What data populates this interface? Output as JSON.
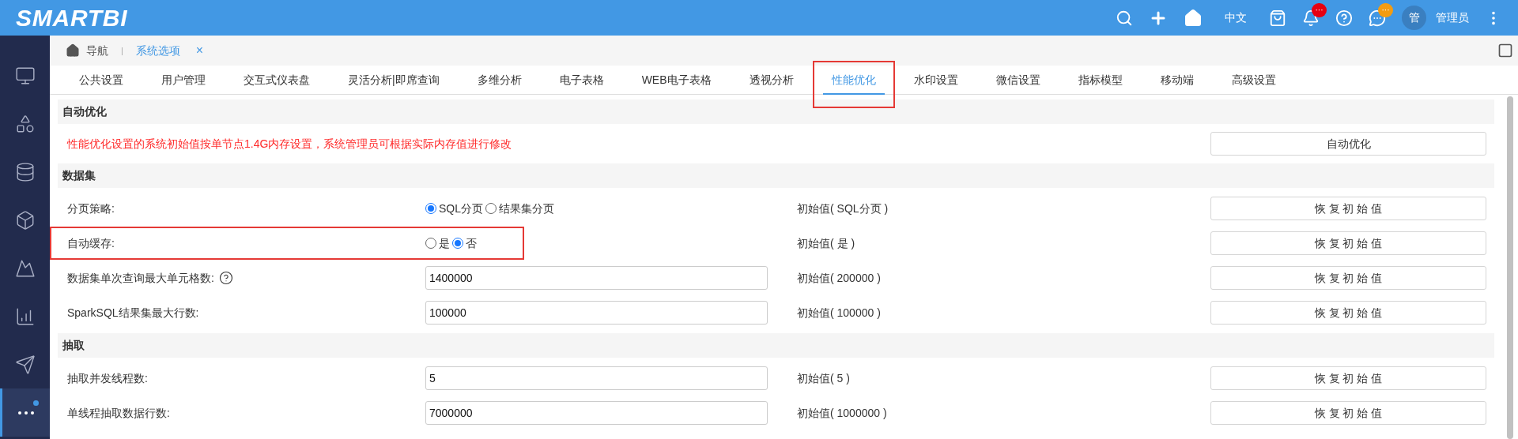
{
  "topbar": {
    "logo": "SMARTBI",
    "language": "中文",
    "notification_badge": "···",
    "message_badge": "···",
    "avatar": "管",
    "user": "管理员"
  },
  "sidebar": {
    "items": [
      {
        "kind": "monitor",
        "selected": false
      },
      {
        "kind": "shapes",
        "selected": false
      },
      {
        "kind": "database",
        "selected": false
      },
      {
        "kind": "cube",
        "selected": false
      },
      {
        "kind": "mountain",
        "selected": false
      },
      {
        "kind": "chart",
        "selected": false
      },
      {
        "kind": "send",
        "selected": false
      },
      {
        "kind": "more",
        "selected": true
      }
    ]
  },
  "breadcrumb": {
    "home": "导航",
    "separator": "|",
    "current": "系统选项",
    "close": "×"
  },
  "tabs": [
    {
      "label": "公共设置",
      "selected": false,
      "highlight": false
    },
    {
      "label": "用户管理",
      "selected": false,
      "highlight": false
    },
    {
      "label": "交互式仪表盘",
      "selected": false,
      "highlight": false
    },
    {
      "label": "灵活分析|即席查询",
      "selected": false,
      "highlight": false
    },
    {
      "label": "多维分析",
      "selected": false,
      "highlight": false
    },
    {
      "label": "电子表格",
      "selected": false,
      "highlight": false
    },
    {
      "label": "WEB电子表格",
      "selected": false,
      "highlight": false
    },
    {
      "label": "透视分析",
      "selected": false,
      "highlight": false
    },
    {
      "label": "性能优化",
      "selected": true,
      "highlight": true
    },
    {
      "label": "水印设置",
      "selected": false,
      "highlight": false
    },
    {
      "label": "微信设置",
      "selected": false,
      "highlight": false
    },
    {
      "label": "指标模型",
      "selected": false,
      "highlight": false
    },
    {
      "label": "移动端",
      "selected": false,
      "highlight": false
    },
    {
      "label": "高级设置",
      "selected": false,
      "highlight": false
    }
  ],
  "sections": [
    {
      "title": "自动优化",
      "rows": [
        {
          "kind": "notice",
          "text": "性能优化设置的系统初始值按单节点1.4G内存设置，系统管理员可根据实际内存值进行修改",
          "button": "自动优化"
        }
      ]
    },
    {
      "title": "数据集",
      "rows": [
        {
          "kind": "radio",
          "label": "分页策略:",
          "highlight": false,
          "options": [
            {
              "label": "SQL分页",
              "selected": true
            },
            {
              "label": "结果集分页",
              "selected": false
            }
          ],
          "initial": "初始值( SQL分页 )",
          "button": "恢 复 初 始 值"
        },
        {
          "kind": "radio",
          "label": "自动缓存:",
          "highlight": true,
          "options": [
            {
              "label": "是",
              "selected": false
            },
            {
              "label": "否",
              "selected": true
            }
          ],
          "initial": "初始值( 是 )",
          "button": "恢 复 初 始 值"
        },
        {
          "kind": "input",
          "label": "数据集单次查询最大单元格数:",
          "help": true,
          "highlight": false,
          "value": "1400000",
          "initial": "初始值( 200000 )",
          "button": "恢 复 初 始 值"
        },
        {
          "kind": "input",
          "label": "SparkSQL结果集最大行数:",
          "help": false,
          "highlight": false,
          "value": "100000",
          "initial": "初始值( 100000 )",
          "button": "恢 复 初 始 值"
        }
      ]
    },
    {
      "title": "抽取",
      "rows": [
        {
          "kind": "input",
          "label": "抽取并发线程数:",
          "help": false,
          "highlight": false,
          "value": "5",
          "initial": "初始值( 5 )",
          "button": "恢 复 初 始 值"
        },
        {
          "kind": "input",
          "label": "单线程抽取数据行数:",
          "help": false,
          "highlight": false,
          "value": "7000000",
          "initial": "初始值( 1000000 )",
          "button": "恢 复 初 始 值"
        }
      ]
    }
  ]
}
